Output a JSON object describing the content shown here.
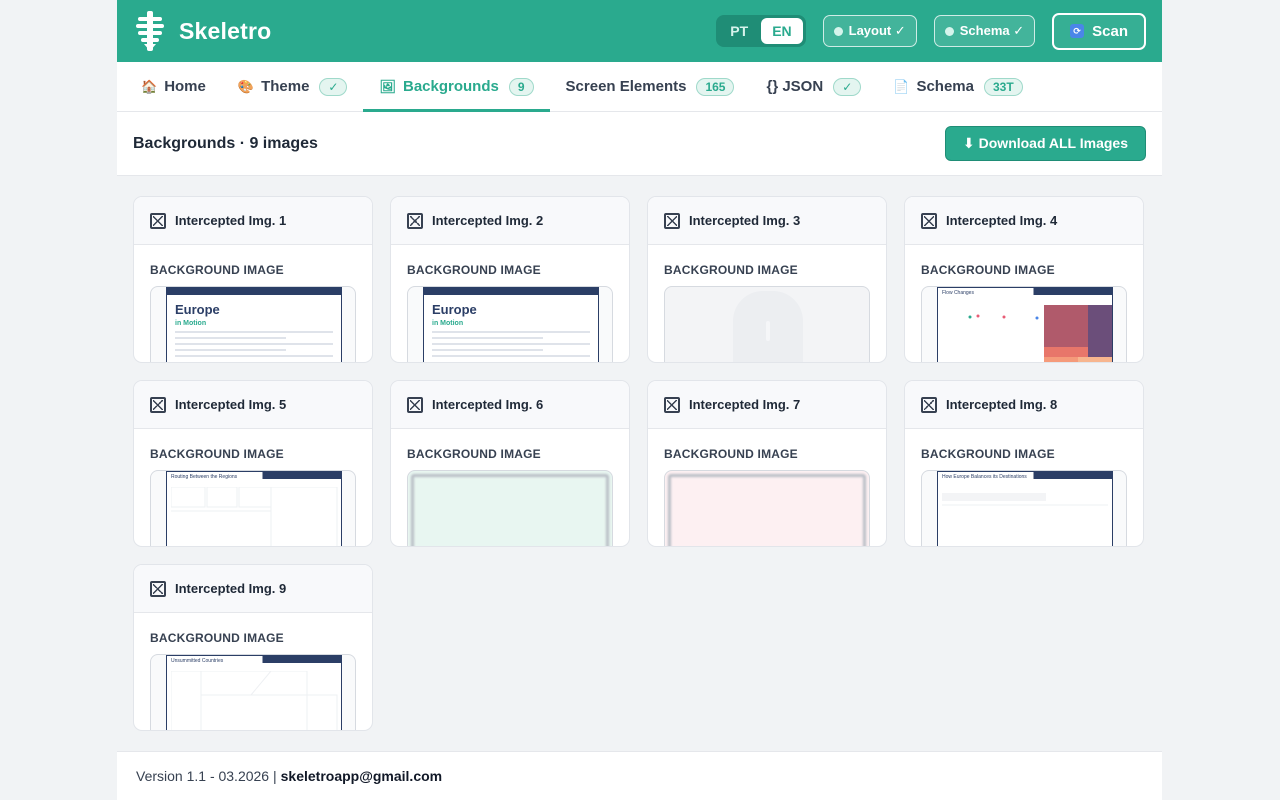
{
  "app": {
    "brand": "Skeletro"
  },
  "header": {
    "lang_pt": "PT",
    "lang_en": "EN",
    "layout_label": "Layout ✓",
    "schema_label": "Schema ✓",
    "scan_label": "Scan",
    "accent": "#2aaa8e"
  },
  "tabs": [
    {
      "label": "Home",
      "icon": "house-icon",
      "badge": ""
    },
    {
      "label": "Theme",
      "icon": "palette-icon",
      "badge": "✓"
    },
    {
      "label": "Backgrounds",
      "icon": "image-icon",
      "badge": "9"
    },
    {
      "label": "Screen Elements",
      "icon": "",
      "badge": "165"
    },
    {
      "label": "{} JSON",
      "icon": "",
      "badge": "✓"
    },
    {
      "label": "Schema",
      "icon": "document-icon",
      "badge": "33T"
    }
  ],
  "section": {
    "title": "Backgrounds · 9 images",
    "download_label": "⬇ Download ALL Images"
  },
  "cards": [
    {
      "title": "Intercepted Img. 1",
      "label": "BACKGROUND IMAGE",
      "europe_title": "Europe",
      "europe_sub": "in Motion"
    },
    {
      "title": "Intercepted Img. 2",
      "label": "BACKGROUND IMAGE",
      "europe_title": "Europe",
      "europe_sub": "in Motion"
    },
    {
      "title": "Intercepted Img. 3",
      "label": "BACKGROUND IMAGE"
    },
    {
      "title": "Intercepted Img. 4",
      "label": "BACKGROUND IMAGE",
      "mini_title": "Flow Changes"
    },
    {
      "title": "Intercepted Img. 5",
      "label": "BACKGROUND IMAGE",
      "mini_title": "Routing Between the Regions"
    },
    {
      "title": "Intercepted Img. 6",
      "label": "BACKGROUND IMAGE"
    },
    {
      "title": "Intercepted Img. 7",
      "label": "BACKGROUND IMAGE"
    },
    {
      "title": "Intercepted Img. 8",
      "label": "BACKGROUND IMAGE",
      "mini_title": "How Europe Balances its Destinations"
    },
    {
      "title": "Intercepted Img. 9",
      "label": "BACKGROUND IMAGE",
      "mini_title": "Unsummitted Countries"
    }
  ],
  "footer": {
    "version": "Version 1.1 - 03.2026 |",
    "email": "skeletroapp@gmail.com"
  }
}
